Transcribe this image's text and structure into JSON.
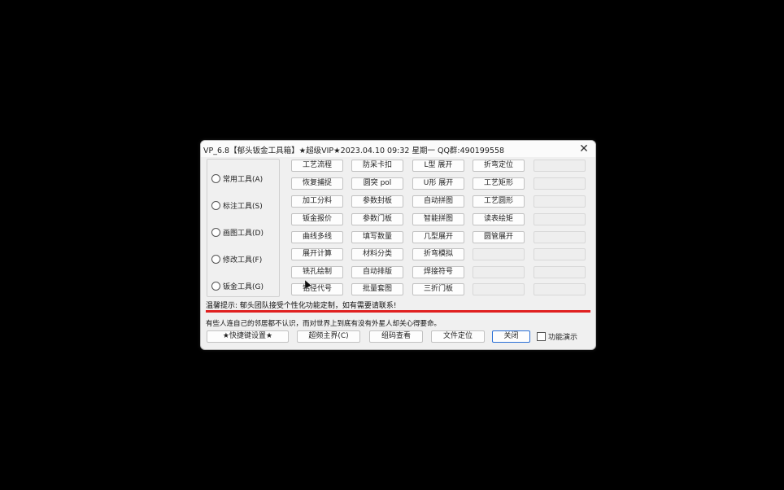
{
  "window": {
    "title": "VP_6.8【郁头钣金工具箱】★超级VIP★2023.04.10 09:32 星期一    QQ群:490199558",
    "close_icon": "✕"
  },
  "radios": [
    "常用工具(A)",
    "标注工具(S)",
    "画图工具(D)",
    "修改工具(F)",
    "钣金工具(G)"
  ],
  "grid": [
    [
      "工艺流程",
      "防呆卡扣",
      "L型 展开",
      "折弯定位",
      ""
    ],
    [
      "恢复捕捉",
      "圆突 pol",
      "U形 展开",
      "工艺矩形",
      ""
    ],
    [
      "加工分料",
      "参数封板",
      "自动拼图",
      "工艺圆形",
      ""
    ],
    [
      "钣金报价",
      "参数门板",
      "智能拼图",
      "读表绘矩",
      ""
    ],
    [
      "曲线多线",
      "填写数量",
      "几型展开",
      "圆管展开",
      ""
    ],
    [
      "展开计算",
      "材料分类",
      "折弯模拟",
      "",
      ""
    ],
    [
      "铣孔绘制",
      "自动排版",
      "焊接符号",
      "",
      ""
    ],
    [
      "钻径代号",
      "批量套图",
      "三折门板",
      "",
      ""
    ]
  ],
  "tip": "温馨提示: 郁头团队接受个性化功能定制，如有需要请联系!",
  "note": "有些人连自己的邻居都不认识，而对世界上到底有没有外星人却关心得要命。",
  "bottom_buttons": [
    "★快捷键设置★",
    "超频主界(C)",
    "组码查看",
    "文件定位",
    "关闭"
  ],
  "demo_checkbox": "功能演示",
  "colors": {
    "background": "#000000",
    "window": "#f0f0f0",
    "divider": "#e02020",
    "focus": "#2a6fd6"
  }
}
